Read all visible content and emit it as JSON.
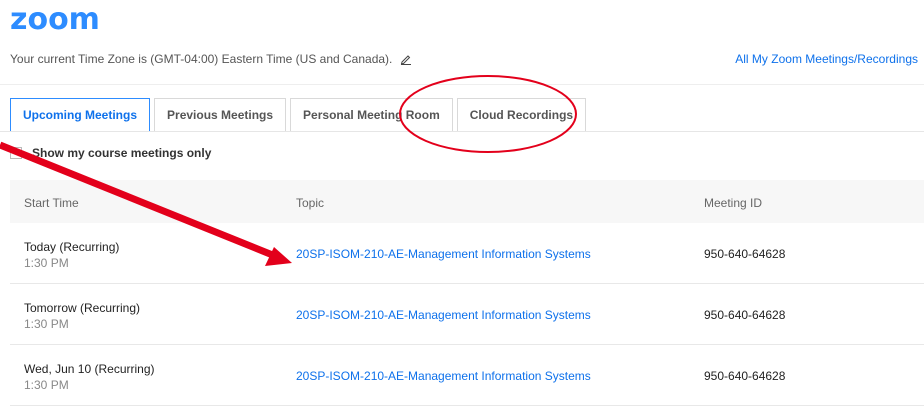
{
  "header": {
    "logo": "zoom",
    "timezone_text": "Your current Time Zone is (GMT-04:00) Eastern Time (US and Canada).",
    "all_meetings_link": "All My Zoom Meetings/Recordings"
  },
  "tabs": [
    {
      "label": "Upcoming Meetings",
      "active": true
    },
    {
      "label": "Previous Meetings",
      "active": false
    },
    {
      "label": "Personal Meeting Room",
      "active": false
    },
    {
      "label": "Cloud Recordings",
      "active": false
    }
  ],
  "filter": {
    "course_only_label": "Show my course meetings only",
    "checked": false
  },
  "table": {
    "headers": [
      "Start Time",
      "Topic",
      "Meeting ID"
    ],
    "rows": [
      {
        "date": "Today (Recurring)",
        "time": "1:30 PM",
        "topic": "20SP-ISOM-210-AE-Management Information Systems",
        "meeting_id": "950-640-64628"
      },
      {
        "date": "Tomorrow (Recurring)",
        "time": "1:30 PM",
        "topic": "20SP-ISOM-210-AE-Management Information Systems",
        "meeting_id": "950-640-64628"
      },
      {
        "date": "Wed, Jun 10 (Recurring)",
        "time": "1:30 PM",
        "topic": "20SP-ISOM-210-AE-Management Information Systems",
        "meeting_id": "950-640-64628"
      }
    ]
  },
  "colors": {
    "brand": "#2d8cff",
    "link": "#0e71eb",
    "annotation": "#e3001b"
  },
  "icons": {
    "edit": "pencil-icon"
  }
}
